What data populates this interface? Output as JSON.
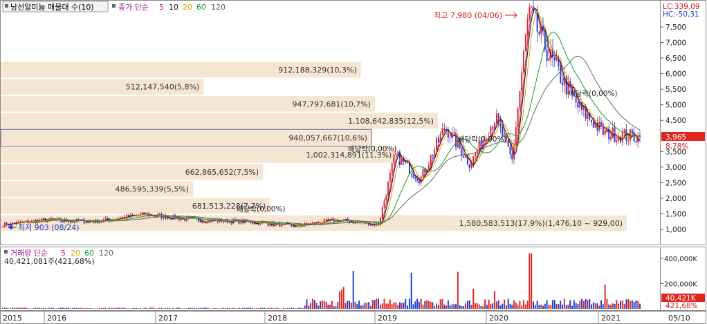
{
  "chart_data": {
    "type": "candlestick",
    "title_bar": {
      "name": "남선알미늄 매물대 수(10)",
      "ma_label": "종가 단순",
      "ma_periods": [
        "5",
        "10",
        "20",
        "60",
        "120"
      ]
    },
    "right_labels": {
      "lc": "LC:339,09",
      "hc": "HC:-50,31",
      "last_price": "3,965",
      "last_pct": "8,78%"
    },
    "volume_header": {
      "label": "거래량 단순",
      "periods": [
        "5",
        "20",
        "60",
        "120"
      ],
      "value": "40,421,081주(421,68%)"
    },
    "volume_right": {
      "last": "40,421K",
      "pct": "421,68%"
    },
    "price_axis": {
      "min": 500,
      "max": 7900,
      "ticks": [
        "7,500",
        "7,000",
        "6,500",
        "6,000",
        "5,500",
        "5,000",
        "4,500",
        "4,000",
        "3,500",
        "3,000",
        "2,500",
        "2,000",
        "1,500",
        "1,000"
      ],
      "tick_values": [
        7500,
        7000,
        6500,
        6000,
        5500,
        5000,
        4500,
        4000,
        3500,
        3000,
        2500,
        2000,
        1500,
        1000
      ]
    },
    "volume_axis": {
      "ticks": [
        "400,000K",
        "200,000K"
      ],
      "tick_values": [
        400000,
        200000
      ],
      "max": 480000
    },
    "x_axis": {
      "labels": [
        "2015",
        "2016",
        "2017",
        "2018",
        "2019",
        "2020",
        "2021",
        "05/10"
      ]
    },
    "volume_profile": [
      {
        "label": "1,580,583,513(17,9%)(1,476,10 ~ 929,00)",
        "pct": 17.9,
        "from": 929,
        "to": 1476
      },
      {
        "label": "681,513,228(7,7%)",
        "pct": 7.7,
        "from": 1476,
        "to": 2023
      },
      {
        "label": "486,595,339(5,5%)",
        "pct": 5.5,
        "from": 2023,
        "to": 2570
      },
      {
        "label": "662,865,652(7,5%)",
        "pct": 7.5,
        "from": 2570,
        "to": 3117
      },
      {
        "label": "1,002,314,891(11,3%)",
        "pct": 11.3,
        "from": 3117,
        "to": 3664
      },
      {
        "label": "940,057,667(10,6%)",
        "pct": 10.6,
        "from": 3664,
        "to": 4211
      },
      {
        "label": "1,108,642,835(12,5%)",
        "pct": 12.5,
        "from": 4211,
        "to": 4758
      },
      {
        "label": "947,797,681(10,7%)",
        "pct": 10.7,
        "from": 4758,
        "to": 5305
      },
      {
        "label": "512,147,540(5,8%)",
        "pct": 5.8,
        "from": 5305,
        "to": 5852
      },
      {
        "label": "912,188,329(10,3%)",
        "pct": 10.3,
        "from": 5852,
        "to": 6399
      }
    ],
    "annotations": {
      "high": "최고 7,980 (04/06)",
      "low": "최저 903 (08/24)",
      "dividend": "배당락(0,00%)"
    },
    "price_path": [
      [
        "2015-01",
        1150
      ],
      [
        "2015-06",
        1300
      ],
      [
        "2015-12",
        1250
      ],
      [
        "2016-06",
        1480
      ],
      [
        "2016-12",
        1300
      ],
      [
        "2017-06",
        1250
      ],
      [
        "2017-12",
        1100
      ],
      [
        "2018-05",
        1300
      ],
      [
        "2018-10",
        1150
      ],
      [
        "2018-12",
        3400
      ],
      [
        "2019-03",
        2600
      ],
      [
        "2019-06",
        4300
      ],
      [
        "2019-09",
        3100
      ],
      [
        "2019-12",
        4600
      ],
      [
        "2020-02",
        3200
      ],
      [
        "2020-04",
        7980
      ],
      [
        "2020-07",
        6300
      ],
      [
        "2020-10",
        4900
      ],
      [
        "2021-01",
        4100
      ],
      [
        "2021-05",
        3965
      ]
    ]
  }
}
